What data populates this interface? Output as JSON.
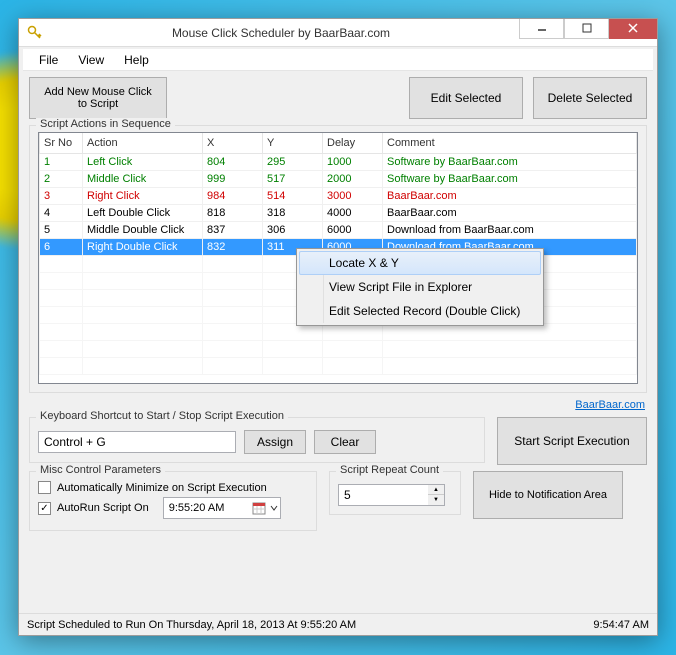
{
  "window": {
    "title": "Mouse Click Scheduler by BaarBaar.com"
  },
  "menu": {
    "file": "File",
    "view": "View",
    "help": "Help"
  },
  "buttons": {
    "add": "Add New Mouse Click to Script",
    "edit": "Edit Selected",
    "delete": "Delete Selected",
    "assign": "Assign",
    "clear": "Clear",
    "start": "Start Script Execution",
    "hide": "Hide to Notification Area"
  },
  "sections": {
    "actions": "Script Actions in Sequence",
    "shortcut": "Keyboard Shortcut to Start / Stop Script Execution",
    "misc": "Misc Control Parameters",
    "repeat": "Script Repeat Count"
  },
  "table": {
    "headers": {
      "sr": "Sr No",
      "action": "Action",
      "x": "X",
      "y": "Y",
      "delay": "Delay",
      "comment": "Comment"
    },
    "rows": [
      {
        "sr": "1",
        "action": "Left Click",
        "x": "804",
        "y": "295",
        "delay": "1000",
        "comment": "Software by BaarBaar.com",
        "cls": "green"
      },
      {
        "sr": "2",
        "action": "Middle Click",
        "x": "999",
        "y": "517",
        "delay": "2000",
        "comment": "Software by BaarBaar.com",
        "cls": "green"
      },
      {
        "sr": "3",
        "action": "Right Click",
        "x": "984",
        "y": "514",
        "delay": "3000",
        "comment": "BaarBaar.com",
        "cls": "red"
      },
      {
        "sr": "4",
        "action": "Left Double Click",
        "x": "818",
        "y": "318",
        "delay": "4000",
        "comment": "BaarBaar.com",
        "cls": ""
      },
      {
        "sr": "5",
        "action": "Middle Double Click",
        "x": "837",
        "y": "306",
        "delay": "6000",
        "comment": "Download from BaarBaar.com",
        "cls": ""
      },
      {
        "sr": "6",
        "action": "Right Double Click",
        "x": "832",
        "y": "311",
        "delay": "6000",
        "comment": "Download from BaarBaar.com",
        "cls": "sel"
      }
    ]
  },
  "context": {
    "locate": "Locate X & Y",
    "viewfile": "View Script File in Explorer",
    "editrec": "Edit Selected Record (Double Click)"
  },
  "shortcut": {
    "value": "Control + G"
  },
  "misc": {
    "automin": "Automatically Minimize on Script Execution",
    "autorun": "AutoRun Script On",
    "time": "9:55:20 AM"
  },
  "repeat": {
    "value": "5"
  },
  "link": "BaarBaar.com",
  "status": {
    "left": "Script Scheduled to Run On Thursday, April 18, 2013 At 9:55:20 AM",
    "right": "9:54:47 AM"
  }
}
